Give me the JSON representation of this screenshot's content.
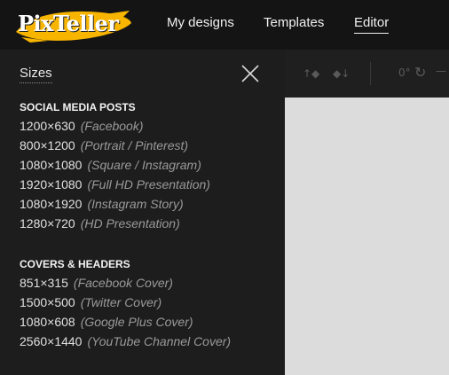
{
  "brand": {
    "logo_text": "PixTeller",
    "accent": "#f7b500"
  },
  "nav": {
    "links": [
      {
        "label": "My designs"
      },
      {
        "label": "Templates"
      },
      {
        "label": "Editor",
        "active": true
      }
    ]
  },
  "toolbar": {
    "rotation": "0°"
  },
  "panel": {
    "title": "Sizes",
    "sections": [
      {
        "heading": "SOCIAL MEDIA POSTS",
        "items": [
          {
            "dim": "1200×630",
            "desc": "(Facebook)"
          },
          {
            "dim": "800×1200",
            "desc": "(Portrait / Pinterest)"
          },
          {
            "dim": "1080×1080",
            "desc": "(Square / Instagram)"
          },
          {
            "dim": "1920×1080",
            "desc": "(Full HD Presentation)"
          },
          {
            "dim": "1080×1920",
            "desc": "(Instagram Story)"
          },
          {
            "dim": "1280×720",
            "desc": "(HD Presentation)"
          }
        ]
      },
      {
        "heading": "COVERS & HEADERS",
        "items": [
          {
            "dim": "851×315",
            "desc": "(Facebook Cover)"
          },
          {
            "dim": "1500×500",
            "desc": "(Twitter Cover)"
          },
          {
            "dim": "1080×608",
            "desc": "(Google Plus Cover)"
          },
          {
            "dim": "2560×1440",
            "desc": "(YouTube Channel Cover)"
          }
        ]
      }
    ]
  }
}
